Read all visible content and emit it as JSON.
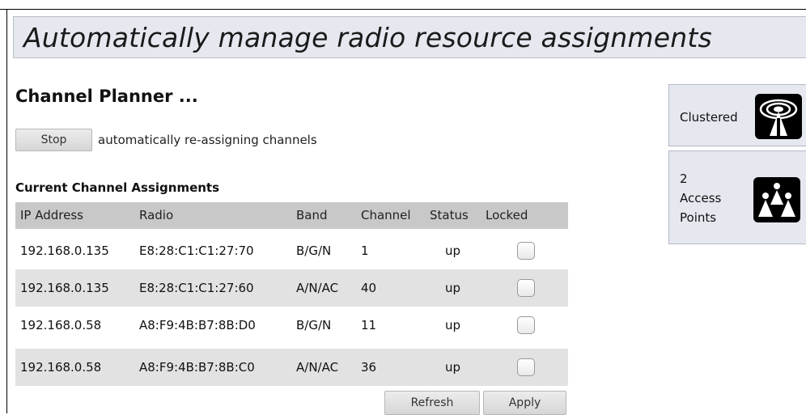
{
  "banner": {
    "title": "Automatically manage radio resource assignments"
  },
  "planner": {
    "heading": "Channel Planner ...",
    "stop_label": "Stop",
    "stop_description": "automatically re-assigning channels"
  },
  "table": {
    "heading": "Current Channel Assignments",
    "columns": [
      "IP Address",
      "Radio",
      "Band",
      "Channel",
      "Status",
      "Locked"
    ],
    "rows": [
      {
        "ip": "192.168.0.135",
        "radio": "E8:28:C1:C1:27:70",
        "band": "B/G/N",
        "channel": "1",
        "status": "up",
        "locked": false
      },
      {
        "ip": "192.168.0.135",
        "radio": "E8:28:C1:C1:27:60",
        "band": "A/N/AC",
        "channel": "40",
        "status": "up",
        "locked": false
      },
      {
        "ip": "192.168.0.58",
        "radio": "A8:F9:4B:B7:8B:D0",
        "band": "B/G/N",
        "channel": "11",
        "status": "up",
        "locked": false
      },
      {
        "ip": "192.168.0.58",
        "radio": "A8:F9:4B:B7:8B:C0",
        "band": "A/N/AC",
        "channel": "36",
        "status": "up",
        "locked": false
      }
    ],
    "refresh_label": "Refresh",
    "apply_label": "Apply"
  },
  "status_panels": {
    "clustered": {
      "label": "Clustered",
      "icon": "radio-tower-icon"
    },
    "access_points": {
      "count": "2",
      "line1": "Access",
      "line2": "Points",
      "icon": "access-points-icon"
    }
  },
  "colors": {
    "banner_bg": "#e6e8ef",
    "table_header_bg": "#c8c8c8",
    "row_alt_bg": "#e2e2e2",
    "icon_bg": "#000000"
  }
}
